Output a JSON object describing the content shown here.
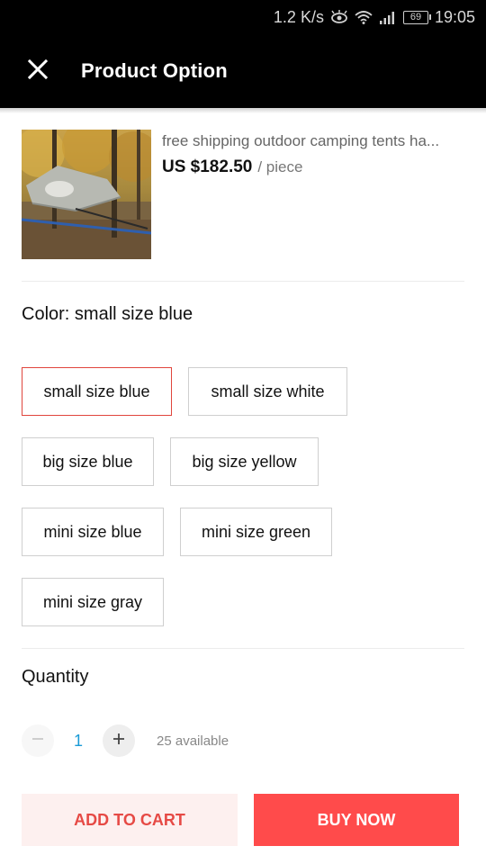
{
  "status_bar": {
    "net_speed": "1.2 K/s",
    "battery": "69",
    "time": "19:05",
    "icons": [
      "eye-icon",
      "wifi-icon",
      "signal-icon",
      "battery-icon"
    ]
  },
  "app_bar": {
    "title": "Product Option",
    "close_icon": "close-icon"
  },
  "product": {
    "title": "free shipping outdoor camping tents ha...",
    "price": "US $182.50",
    "unit": "/ piece"
  },
  "color": {
    "label": "Color: small size blue",
    "selected": "small size blue",
    "options": [
      "small size blue",
      "small size white",
      "big size blue",
      "big size yellow",
      "mini size blue",
      "mini size green",
      "mini size gray"
    ]
  },
  "quantity": {
    "label": "Quantity",
    "value": "1",
    "available": "25 available",
    "minus_icon": "minus-icon",
    "plus_icon": "plus-icon"
  },
  "actions": {
    "add_to_cart": "ADD TO CART",
    "buy_now": "BUY NOW"
  },
  "colors": {
    "accent": "#ff4b4b",
    "selected_border": "#e0453c",
    "quantity_value": "#1a9bd6"
  }
}
